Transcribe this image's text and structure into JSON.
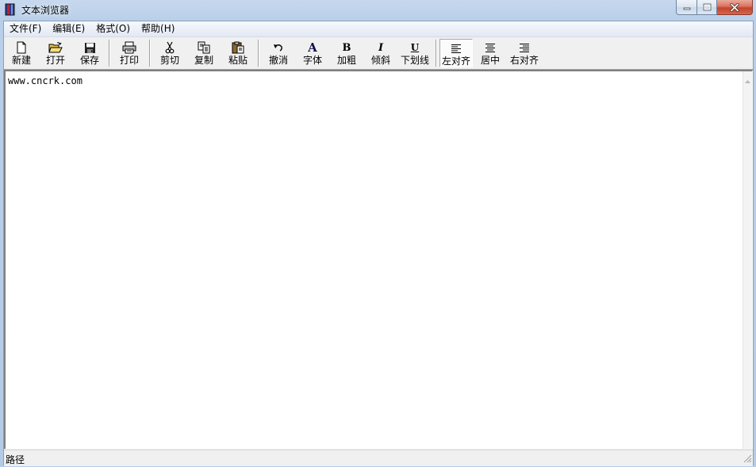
{
  "window": {
    "title": "文本浏览器",
    "app_icon": "book-icon"
  },
  "caption_buttons": {
    "minimize": "minimize-icon",
    "maximize": "maximize-icon",
    "close": "close-icon"
  },
  "menu": [
    {
      "label": "文件(F)"
    },
    {
      "label": "编辑(E)"
    },
    {
      "label": "格式(O)"
    },
    {
      "label": "帮助(H)"
    }
  ],
  "toolbar": {
    "buttons": [
      {
        "id": "new",
        "label": "新建",
        "icon": "new-file-icon"
      },
      {
        "id": "open",
        "label": "打开",
        "icon": "open-folder-icon"
      },
      {
        "id": "save",
        "label": "保存",
        "icon": "save-disk-icon"
      },
      {
        "id": "print",
        "label": "打印",
        "icon": "printer-icon"
      },
      {
        "id": "cut",
        "label": "剪切",
        "icon": "scissors-icon"
      },
      {
        "id": "copy",
        "label": "复制",
        "icon": "copy-icon"
      },
      {
        "id": "paste",
        "label": "粘贴",
        "icon": "paste-icon"
      },
      {
        "id": "undo",
        "label": "撤消",
        "icon": "undo-icon"
      },
      {
        "id": "font",
        "label": "字体",
        "icon": "font-icon",
        "glyph": "A"
      },
      {
        "id": "bold",
        "label": "加粗",
        "icon": "bold-icon",
        "glyph": "B"
      },
      {
        "id": "italic",
        "label": "倾斜",
        "icon": "italic-icon",
        "glyph": "I"
      },
      {
        "id": "underline",
        "label": "下划线",
        "icon": "underline-icon",
        "glyph": "U"
      },
      {
        "id": "align_left",
        "label": "左对齐",
        "icon": "align-left-icon",
        "pressed": true
      },
      {
        "id": "align_center",
        "label": "居中",
        "icon": "align-center-icon"
      },
      {
        "id": "align_right",
        "label": "右对齐",
        "icon": "align-right-icon"
      }
    ]
  },
  "editor": {
    "content": "www.cncrk.com"
  },
  "statusbar": {
    "text": "路径"
  }
}
